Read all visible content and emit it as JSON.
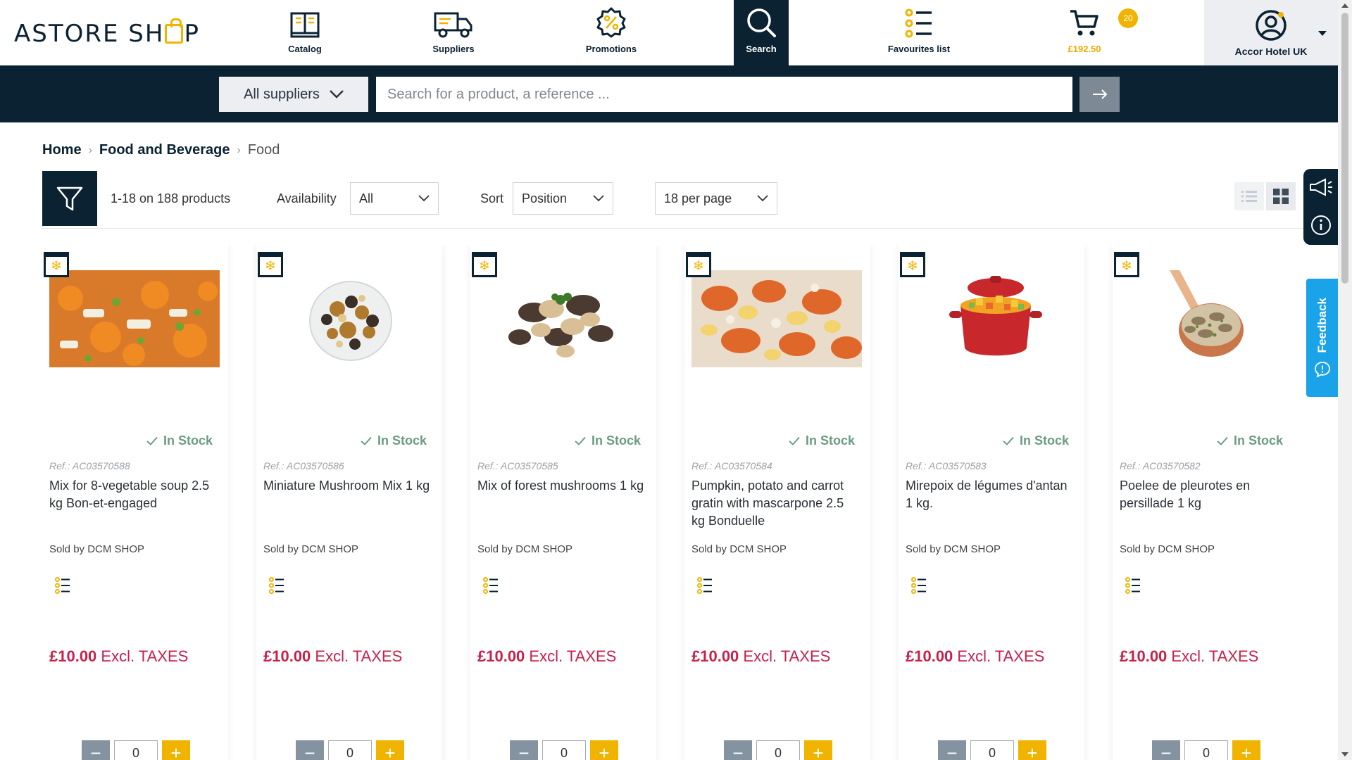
{
  "header": {
    "logo": "ASTORE SH",
    "logo_tail": "P",
    "nav": [
      {
        "label": "Catalog"
      },
      {
        "label": "Suppliers"
      },
      {
        "label": "Promotions"
      },
      {
        "label": "Search"
      },
      {
        "label": "Favourites list"
      }
    ],
    "cart": {
      "badge": "20",
      "total": "£192.50"
    },
    "account": {
      "label": "Accor Hotel UK"
    }
  },
  "search": {
    "supplier_label": "All suppliers",
    "placeholder": "Search for a product, a reference ...",
    "go_icon": "arrow-right-icon"
  },
  "breadcrumb": {
    "home": "Home",
    "category": "Food and Beverage",
    "current": "Food"
  },
  "toolbar": {
    "count": "1-18 on 188 products",
    "availability_label": "Availability",
    "availability_value": "All",
    "sort_label": "Sort",
    "sort_value": "Position",
    "per_page_value": "18 per page"
  },
  "side": {
    "feedback_label": "Feedback"
  },
  "colors": {
    "navy": "#0b2233",
    "accent": "#f0b400",
    "price": "#c8204a",
    "stock": "#6b9c83",
    "feedback": "#1aa3e8"
  },
  "products": [
    {
      "stock": "In Stock",
      "ref": "Ref.: AC03570588",
      "name": "Mix for 8-vegetable soup 2.5 kg Bon-et-engaged",
      "seller": "Sold by DCM SHOP",
      "price": "£10.00",
      "taxes": "Excl. TAXES",
      "qty": "0"
    },
    {
      "stock": "In Stock",
      "ref": "Ref.: AC03570586",
      "name": "Miniature Mushroom Mix 1 kg",
      "seller": "Sold by DCM SHOP",
      "price": "£10.00",
      "taxes": "Excl. TAXES",
      "qty": "0"
    },
    {
      "stock": "In Stock",
      "ref": "Ref.: AC03570585",
      "name": "Mix of forest mushrooms 1 kg",
      "seller": "Sold by DCM SHOP",
      "price": "£10.00",
      "taxes": "Excl. TAXES",
      "qty": "0"
    },
    {
      "stock": "In Stock",
      "ref": "Ref.: AC03570584",
      "name": "Pumpkin, potato and carrot gratin with mascarpone 2.5 kg Bonduelle",
      "seller": "Sold by DCM SHOP",
      "price": "£10.00",
      "taxes": "Excl. TAXES",
      "qty": "0"
    },
    {
      "stock": "In Stock",
      "ref": "Ref.: AC03570583",
      "name": "Mirepoix de légumes d'antan 1 kg.",
      "seller": "Sold by DCM SHOP",
      "price": "£10.00",
      "taxes": "Excl. TAXES",
      "qty": "0"
    },
    {
      "stock": "In Stock",
      "ref": "Ref.: AC03570582",
      "name": "Poelee de pleurotes en persillade 1 kg",
      "seller": "Sold by DCM SHOP",
      "price": "£10.00",
      "taxes": "Excl. TAXES",
      "qty": "0"
    }
  ]
}
